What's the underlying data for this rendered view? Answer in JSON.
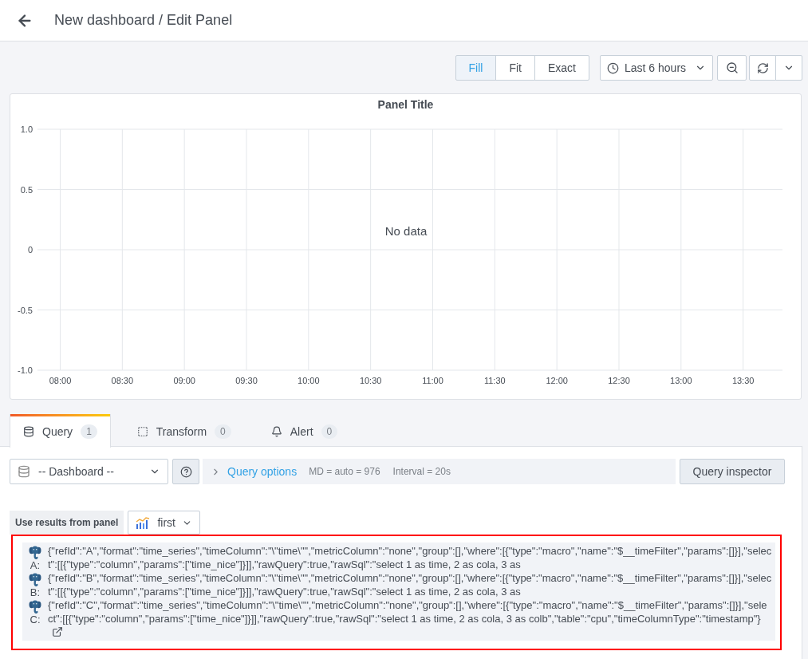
{
  "header": {
    "title": "New dashboard / Edit Panel"
  },
  "toolbar": {
    "view_modes": [
      {
        "label": "Fill",
        "selected": true
      },
      {
        "label": "Fit",
        "selected": false
      },
      {
        "label": "Exact",
        "selected": false
      }
    ],
    "time_range": "Last 6 hours"
  },
  "panel": {
    "message": "No data",
    "chart_data": {
      "type": "line",
      "title": "Panel Title",
      "grid": true,
      "categories": [
        "08:00",
        "08:30",
        "09:00",
        "09:30",
        "10:00",
        "10:30",
        "11:00",
        "11:30",
        "12:00",
        "12:30",
        "13:00",
        "13:30"
      ],
      "ylim": [
        -1,
        1
      ],
      "yticks": [
        {
          "value": 1,
          "label": "1.0"
        },
        {
          "value": 0.5,
          "label": "0.5"
        },
        {
          "value": 0,
          "label": "0"
        },
        {
          "value": -0.5,
          "label": "-0.5"
        },
        {
          "value": -1,
          "label": "-1.0"
        }
      ]
    }
  },
  "tabs": [
    {
      "label": "Query",
      "count": "1",
      "selected": true
    },
    {
      "label": "Transform",
      "count": "0",
      "selected": false
    },
    {
      "label": "Alert",
      "count": "0",
      "selected": false
    }
  ],
  "query_row": {
    "datasource": "-- Dashboard --",
    "options_label": "Query options",
    "max_data_points": "MD = auto = 976",
    "interval": "Interval = 20s",
    "inspector_button": "Query inspector"
  },
  "source_panel": {
    "label": "Use results from panel",
    "value": "first"
  },
  "query_list": {
    "highlighted": true,
    "items": [
      {
        "ref": "A:",
        "text": "{\"refId\":\"A\",\"format\":\"time_series\",\"timeColumn\":\"\\\"time\\\"\",\"metricColumn\":\"none\",\"group\":[],\"where\":[{\"type\":\"macro\",\"name\":\"$__timeFilter\",\"params\":[]}],\"select\":[[{\"type\":\"column\",\"params\":[\"time_nice\"]}]],\"rawQuery\":true,\"rawSql\":\"select 1 as time, 2 as cola, 3 as"
      },
      {
        "ref": "B:",
        "text": "{\"refId\":\"B\",\"format\":\"time_series\",\"timeColumn\":\"\\\"time\\\"\",\"metricColumn\":\"none\",\"group\":[],\"where\":[{\"type\":\"macro\",\"name\":\"$__timeFilter\",\"params\":[]}],\"select\":[[{\"type\":\"column\",\"params\":[\"time_nice\"]}]],\"rawQuery\":true,\"rawSql\":\"select 1 as time, 2 as cola, 3 as"
      },
      {
        "ref": "C:",
        "text": "{\"refId\":\"C\",\"format\":\"time_series\",\"timeColumn\":\"\\\"time\\\"\",\"metricColumn\":\"none\",\"group\":[],\"where\":[{\"type\":\"macro\",\"name\":\"$__timeFilter\",\"params\":[]}],\"select\":[[{\"type\":\"column\",\"params\":[\"time_nice\"]}]],\"rawQuery\":true,\"rawSql\":\"select 1 as time, 2 as cola, 3 as colb\",\"table\":\"cpu\",\"timeColumnType\":\"timestamp\"}",
        "external_link": true
      }
    ]
  }
}
